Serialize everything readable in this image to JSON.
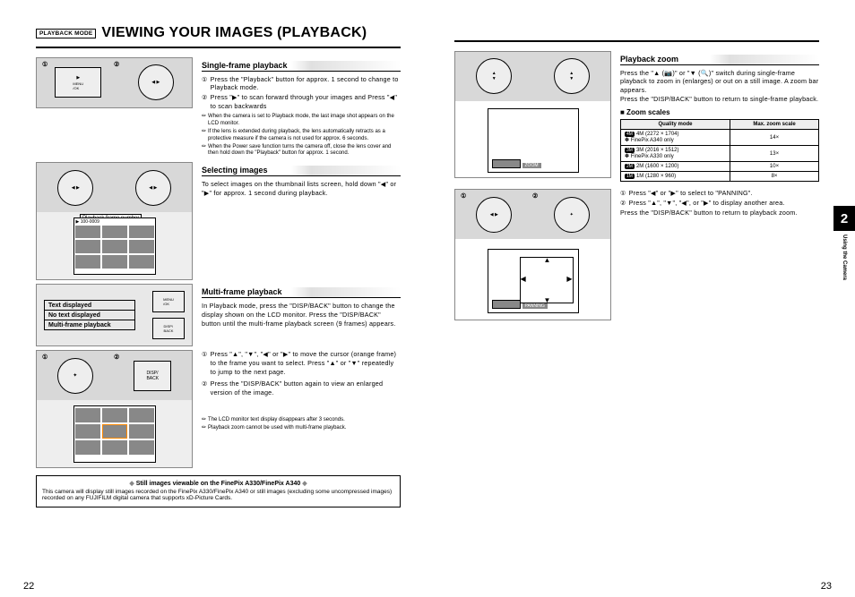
{
  "header": {
    "mode_badge": "PLAYBACK MODE",
    "title": "VIEWING YOUR IMAGES (PLAYBACK)"
  },
  "sections": {
    "single_frame": {
      "heading": "Single-frame playback",
      "step1": "Press the \"Playback\" button for approx. 1 second to change to Playback mode.",
      "step2": "Press \"▶\" to scan forward through your images and Press \"◀\" to scan backwards",
      "notes": [
        "When the camera is set to Playback mode, the last image shot appears on the LCD monitor.",
        "If the lens is extended during playback, the lens automatically retracts as a protective measure if the camera is not used for approx. 6 seconds.",
        "When the Power save function turns the camera off, close the lens cover and then hold down the \"Playback\" button for approx. 1 second."
      ]
    },
    "selecting": {
      "heading": "Selecting images",
      "body": "To select images on the thumbnail lists screen, hold down \"◀\" or \"▶\" for approx. 1 second during playback."
    },
    "multi_frame": {
      "heading": "Multi-frame playback",
      "body": "In Playback mode, press the \"DISP/BACK\" button to change the display shown on the LCD monitor. Press the \"DISP/BACK\" button until the multi-frame playback screen (9 frames) appears.",
      "step1": "Press \"▲\", \"▼\", \"◀\" or \"▶\" to move the cursor (orange frame) to the frame you want to select. Press \"▲\" or \"▼\" repeatedly to jump to the next page.",
      "step2": "Press the \"DISP/BACK\" button again to view an enlarged version of the image.",
      "notes": [
        "The LCD monitor text display disappears after 3 seconds.",
        "Playback zoom cannot be used with multi-frame playback."
      ]
    },
    "zoom": {
      "heading": "Playback zoom",
      "body1": "Press the \"▲ (📷)\" or \"▼ (🔍)\" switch during single-frame playback to zoom in (enlarges) or out on a still image. A zoom bar appears.",
      "body2": "Press the \"DISP/BACK\" button to return to single-frame playback.",
      "scales_heading": "■ Zoom scales",
      "table": {
        "h1": "Quality mode",
        "h2": "Max. zoom scale",
        "rows": [
          {
            "mode": "4M (2272 × 1704)\n✽ FinePix A340 only",
            "scale": "14×"
          },
          {
            "mode": "3M (2016 × 1512)\n✽ FinePix A330 only",
            "scale": "13×"
          },
          {
            "mode": "2M (1600 × 1200)",
            "scale": "10×"
          },
          {
            "mode": "1M (1280 × 960)",
            "scale": "8×"
          }
        ]
      },
      "step1": "Press \"◀\" or \"▶\" to select to \"PANNING\".",
      "step2": "Press \"▲\", \"▼\", \"◀\", or \"▶\" to display another area.",
      "body3": "Press the \"DISP/BACK\" button to return to playback zoom."
    }
  },
  "illus": {
    "playback_frame_label": "Playback frame number",
    "menu_items": [
      "Text displayed",
      "No text displayed",
      "Multi-frame playback"
    ],
    "btn_labels": {
      "menu": "MENU\n/OK",
      "disp": "DISP/\nBACK"
    }
  },
  "footer": {
    "title": "Still images viewable on the FinePix A330/FinePix A340",
    "body": "This camera will display still images recorded on the FinePix A330/FinePix A340 or still images (excluding some uncompressed images) recorded on any FUJIFILM digital camera that supports xD-Picture Cards."
  },
  "chapter": {
    "num": "2",
    "label": "Using the Camera"
  },
  "pages": {
    "left": "22",
    "right": "23"
  }
}
